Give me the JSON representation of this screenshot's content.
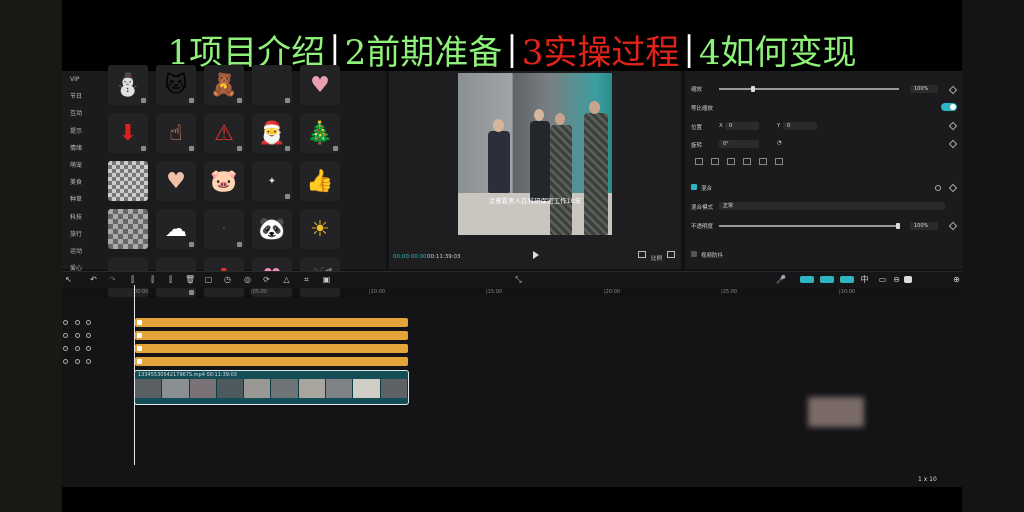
{
  "banner": [
    {
      "text": "1项目介绍",
      "color": "#8ff07a"
    },
    {
      "text": "2前期准备",
      "color": "#8ff07a"
    },
    {
      "text": "3实操过程",
      "color": "#e2231a"
    },
    {
      "text": "4如何变现",
      "color": "#8ff07a"
    }
  ],
  "banner_separator": "|",
  "sticker_categories": [
    "VIP",
    "节日",
    "互动",
    "提示",
    "情绪",
    "萌宠",
    "美食",
    "种草",
    "科技",
    "旅行",
    "运动",
    "爱心"
  ],
  "stickers": [
    "snowman-sticker",
    "cat-sticker",
    "bear-sticker",
    "blank-sticker",
    "heart-sticker",
    "empty-sticker",
    "arrow-down-sticker",
    "hand-sticker",
    "warning-sticker",
    "santa-hat-sticker",
    "santa-sticker",
    "blank-sticker",
    "mosaic-sticker",
    "heart-glow-sticker",
    "pig-sticker",
    "sparkle-sticker",
    "thumbs-up-sticker",
    "empty-sticker",
    "mosaic2-sticker",
    "cloud-face-sticker",
    "dots-sticker",
    "panda-sticker",
    "sun-sticker",
    "empty-sticker",
    "blank-sticker",
    "text-sticker",
    "arrow-sticker",
    "pink-heart-sticker",
    "butterfly-sticker",
    "empty-sticker"
  ],
  "player": {
    "subtitle": "注意看男人在科研保密工作10年",
    "current_time": "00:00:00:00",
    "total_time": "00:11:39:03",
    "ratio_label": "比例"
  },
  "props": {
    "scale_label": "缩放",
    "scale_value": "100%",
    "uniform_scale_label": "等比缩放",
    "position_label": "位置",
    "pos_x_label": "X",
    "pos_x": "0",
    "pos_y_label": "Y",
    "pos_y": "0",
    "rotate_label": "旋转",
    "rotate_value": "0°",
    "blend_label": "混合",
    "blend_mode_label": "混合模式",
    "blend_mode_value": "正常",
    "opacity_label": "不透明度",
    "opacity_value": "100%",
    "anti_shake_label": "视频防抖"
  },
  "ruler": [
    "00:00",
    "|05:00",
    "|10:00",
    "|15:00",
    "|20:00",
    "|25:00",
    "|30:00"
  ],
  "video_clip": {
    "label": "1334553054217967S.mp4  00:11:39:03"
  },
  "corner": "1 x 10"
}
